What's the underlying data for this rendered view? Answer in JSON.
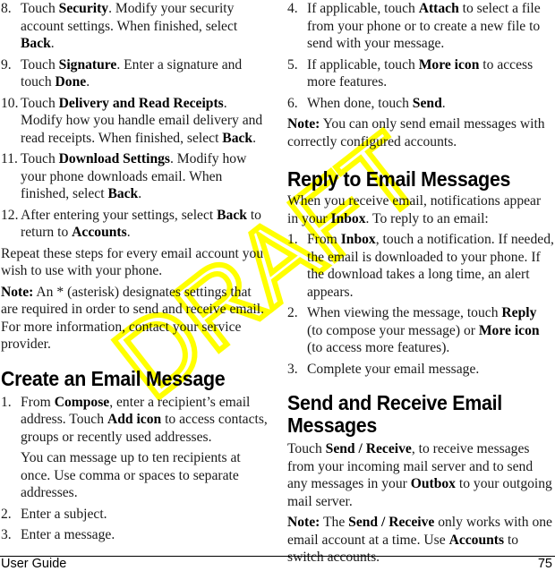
{
  "left_column": {
    "steps_continued": [
      {
        "num": "8.",
        "parts": [
          {
            "t": "Touch "
          },
          {
            "b": "Security"
          },
          {
            "t": ". Modify your security account settings. When finished, select "
          },
          {
            "b": "Back"
          },
          {
            "t": "."
          }
        ]
      },
      {
        "num": "9.",
        "parts": [
          {
            "t": "Touch "
          },
          {
            "b": "Signature"
          },
          {
            "t": ". Enter a signature and touch "
          },
          {
            "b": "Done"
          },
          {
            "t": "."
          }
        ]
      },
      {
        "num": "10.",
        "parts": [
          {
            "t": "Touch "
          },
          {
            "b": "Delivery and Read Receipts"
          },
          {
            "t": ". Modify how you handle email delivery and read receipts. When finished, select "
          },
          {
            "b": "Back"
          },
          {
            "t": "."
          }
        ]
      },
      {
        "num": "11.",
        "parts": [
          {
            "t": "Touch "
          },
          {
            "b": "Download Settings"
          },
          {
            "t": ". Modify how your phone downloads email. When finished, select "
          },
          {
            "b": "Back"
          },
          {
            "t": "."
          }
        ]
      },
      {
        "num": "12.",
        "parts": [
          {
            "t": "After entering your settings, select "
          },
          {
            "b": "Back"
          },
          {
            "t": " to return to "
          },
          {
            "b": "Accounts"
          },
          {
            "t": "."
          }
        ]
      }
    ],
    "repeat_text": "Repeat these steps for every email account you wish to use with your phone.",
    "note": {
      "label": "Note:",
      "text": " An * (asterisk) designates settings that are required in order to send and receive email. For more information, contact your service provider."
    },
    "create_heading": "Create an Email Message",
    "create_steps": [
      {
        "num": "1.",
        "parts": [
          {
            "t": "From "
          },
          {
            "b": "Compose"
          },
          {
            "t": ", enter a recipient’s email address. Touch "
          },
          {
            "b": "Add icon"
          },
          {
            "t": " to access contacts, groups or recently used addresses."
          }
        ]
      },
      {
        "num": "2.",
        "parts": [
          {
            "t": "Enter a subject."
          }
        ]
      },
      {
        "num": "3.",
        "parts": [
          {
            "t": "Enter a message."
          }
        ]
      }
    ],
    "create_step1_extra": "You can message up to ten recipients at once. Use comma or spaces to separate addresses."
  },
  "right_column": {
    "create_steps_continued": [
      {
        "num": "4.",
        "parts": [
          {
            "t": "If applicable, touch "
          },
          {
            "b": "Attach"
          },
          {
            "t": " to select a file from your phone or to create a new file to send with your message."
          }
        ]
      },
      {
        "num": "5.",
        "parts": [
          {
            "t": "If applicable, touch "
          },
          {
            "b": "More icon"
          },
          {
            "t": " to access more features."
          }
        ]
      },
      {
        "num": "6.",
        "parts": [
          {
            "t": "When done, touch "
          },
          {
            "b": "Send"
          },
          {
            "t": "."
          }
        ]
      }
    ],
    "note1": {
      "label": "Note:",
      "text": " You can only send email messages with correctly configured accounts."
    },
    "reply_heading": "Reply to Email Messages",
    "reply_intro": [
      {
        "t": "When you receive email, notifications appear in your "
      },
      {
        "b": "Inbox"
      },
      {
        "t": ". To reply to an email:"
      }
    ],
    "reply_steps": [
      {
        "num": "1.",
        "parts": [
          {
            "t": "From "
          },
          {
            "b": "Inbox"
          },
          {
            "t": ", touch a notification. If needed, the email is downloaded to your phone. If the download takes a long time, an alert appears."
          }
        ]
      },
      {
        "num": "2.",
        "parts": [
          {
            "t": "When viewing the message, touch "
          },
          {
            "b": "Reply"
          },
          {
            "t": " (to compose your message) or "
          },
          {
            "b": "More icon"
          },
          {
            "t": " (to access more features)."
          }
        ]
      },
      {
        "num": "3.",
        "parts": [
          {
            "t": "Complete your email message."
          }
        ]
      }
    ],
    "send_heading": "Send and Receive Email Messages",
    "send_text": [
      {
        "t": "Touch "
      },
      {
        "b": "Send / Receive"
      },
      {
        "t": ", to receive messages from your incoming mail server and to send any messages in your "
      },
      {
        "b": "Outbox"
      },
      {
        "t": " to your outgoing mail server."
      }
    ],
    "note2": [
      {
        "b": "Note:"
      },
      {
        "t": " The "
      },
      {
        "b": "Send / Receive"
      },
      {
        "t": " only works with one email account at a time. Use "
      },
      {
        "b": "Accounts"
      },
      {
        "t": " to switch accounts."
      }
    ]
  },
  "footer": {
    "left": "User Guide",
    "page_number": "75"
  },
  "watermark": {
    "text": "DRAFT",
    "color": "#ffff00"
  }
}
